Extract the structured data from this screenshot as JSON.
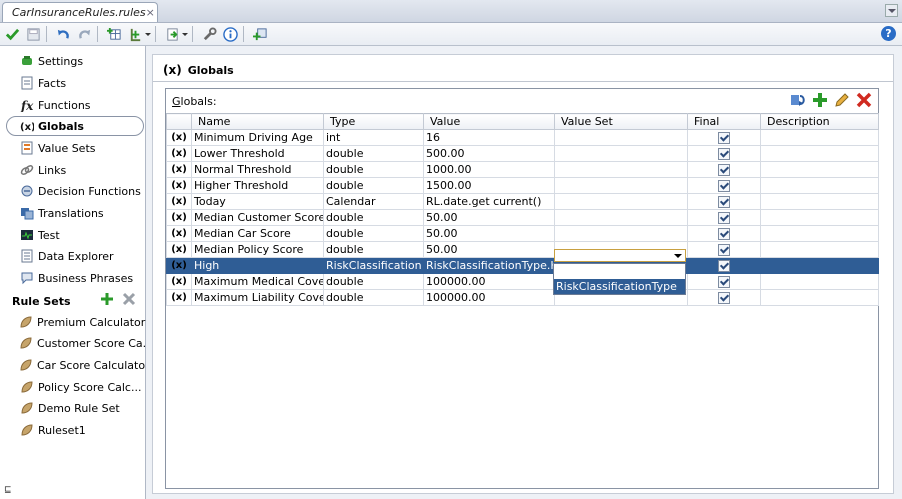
{
  "tab": {
    "title": "CarInsuranceRules.rules",
    "close": "×"
  },
  "toolbar": {
    "buttons": [
      "validate-icon",
      "save-icon",
      "undo-icon",
      "redo-icon",
      "add-decision-table-icon",
      "add-ruleset-icon",
      "import-icon",
      "tools-icon",
      "info-icon",
      "test-icon"
    ],
    "help": "?"
  },
  "nav": {
    "items": [
      {
        "label": "Settings",
        "icon": "settings-icon"
      },
      {
        "label": "Facts",
        "icon": "facts-icon"
      },
      {
        "label": "Functions",
        "icon": "functions-icon"
      },
      {
        "label": "Globals",
        "icon": "globals-icon",
        "selected": true
      },
      {
        "label": "Value Sets",
        "icon": "value-sets-icon"
      },
      {
        "label": "Links",
        "icon": "links-icon"
      },
      {
        "label": "Decision Functions",
        "icon": "decision-functions-icon"
      },
      {
        "label": "Translations",
        "icon": "translations-icon"
      },
      {
        "label": "Test",
        "icon": "test-icon"
      },
      {
        "label": "Data Explorer",
        "icon": "data-explorer-icon"
      },
      {
        "label": "Business Phrases",
        "icon": "business-phrases-icon"
      }
    ],
    "rulesets_header": "Rule Sets",
    "rulesets": [
      "Premium Calculator",
      "Customer Score Ca...",
      "Car Score Calculator",
      "Policy Score Calc...",
      "Demo Rule Set",
      "Ruleset1"
    ],
    "bottom_glyph": "⊑"
  },
  "page": {
    "title_symbol": "(x)",
    "title": "Globals",
    "grid_label": "Globals:",
    "grid_label_mnemonic": "G",
    "grid_label_rest": "lobals:"
  },
  "table": {
    "headers": [
      "",
      "Name",
      "Type",
      "Value",
      "Value Set",
      "Final",
      "Description"
    ],
    "row_symbol": "(x)",
    "rows": [
      {
        "name": "Minimum Driving Age",
        "type": "int",
        "value": "16",
        "value_set": "",
        "final": true,
        "description": ""
      },
      {
        "name": "Lower Threshold",
        "type": "double",
        "value": "500.00",
        "value_set": "",
        "final": true,
        "description": ""
      },
      {
        "name": "Normal Threshold",
        "type": "double",
        "value": "1000.00",
        "value_set": "",
        "final": true,
        "description": ""
      },
      {
        "name": "Higher Threshold",
        "type": "double",
        "value": "1500.00",
        "value_set": "",
        "final": true,
        "description": ""
      },
      {
        "name": "Today",
        "type": "Calendar",
        "value": "RL.date.get current()",
        "value_set": "",
        "final": true,
        "description": ""
      },
      {
        "name": "Median Customer Score",
        "type": "double",
        "value": "50.00",
        "value_set": "",
        "final": true,
        "description": ""
      },
      {
        "name": "Median Car Score",
        "type": "double",
        "value": "50.00",
        "value_set": "",
        "final": true,
        "description": ""
      },
      {
        "name": "Median Policy Score",
        "type": "double",
        "value": "50.00",
        "value_set": "",
        "final": true,
        "description": ""
      },
      {
        "name": "High",
        "type": "RiskClassification",
        "value": "RiskClassificationType.H...",
        "value_set": "",
        "final": true,
        "description": "",
        "selected": true
      },
      {
        "name": "Maximum Medical Cover...",
        "type": "double",
        "value": "100000.00",
        "value_set": "",
        "final": true,
        "description": ""
      },
      {
        "name": "Maximum Liability Cover...",
        "type": "double",
        "value": "100000.00",
        "value_set": "",
        "final": true,
        "description": ""
      }
    ]
  },
  "value_set_dropdown": {
    "selected": "",
    "options": [
      "",
      "RiskClassificationType"
    ],
    "highlighted": "RiskClassificationType"
  }
}
